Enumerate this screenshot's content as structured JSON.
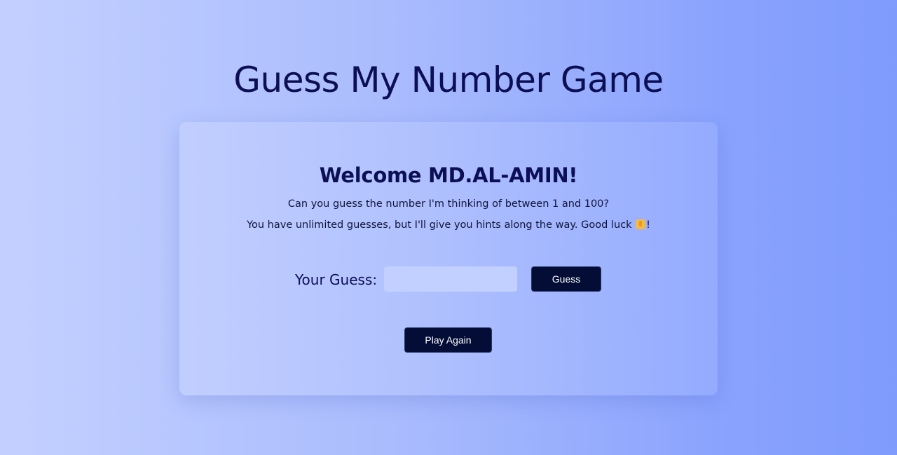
{
  "header": {
    "title": "Guess My Number Game"
  },
  "card": {
    "welcome": "Welcome MD.AL-AMIN!",
    "intro_line_1": "Can you guess the number I'm thinking of between 1 and 100?",
    "intro_line_2_before_icon": "You have unlimited guesses, but I'll give you hints along the way. Good luck",
    "intro_line_2_after_icon": "!",
    "intro_icon": "thumbs-up-icon"
  },
  "guess_form": {
    "label": "Your Guess:",
    "input_value": "",
    "input_placeholder": "",
    "guess_button_label": "Guess"
  },
  "actions": {
    "play_again_label": "Play Again"
  },
  "colors": {
    "background_start": "#c3d0ff",
    "background_end": "#7f9bfc",
    "title_color": "#0d0f55",
    "button_bg": "#040d36",
    "input_bg": "#c2d0ff"
  }
}
